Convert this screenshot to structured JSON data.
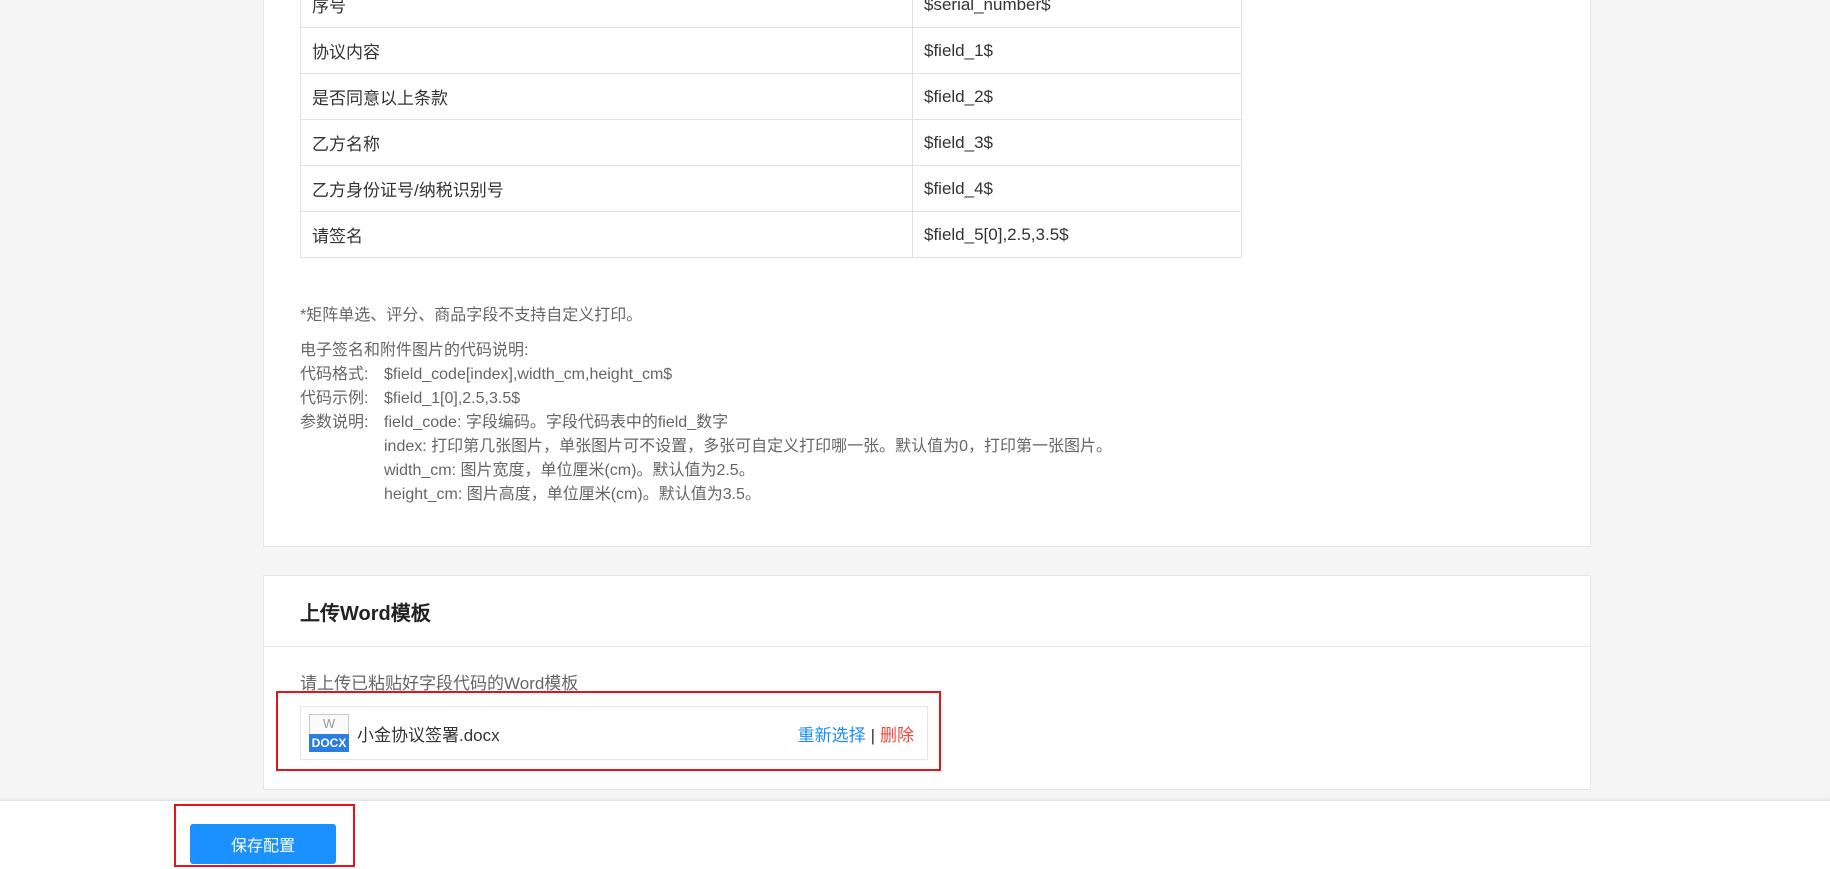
{
  "field_table": {
    "rows": [
      {
        "name": "序号",
        "code": "$serial_number$"
      },
      {
        "name": "协议内容",
        "code": "$field_1$"
      },
      {
        "name": "是否同意以上条款",
        "code": "$field_2$"
      },
      {
        "name": "乙方名称",
        "code": "$field_3$"
      },
      {
        "name": "乙方身份证号/纳税识别号",
        "code": "$field_4$"
      },
      {
        "name": "请签名",
        "code": "$field_5[0],2.5,3.5$"
      }
    ]
  },
  "note": "*矩阵单选、评分、商品字段不支持自定义打印。",
  "help": {
    "title": "电子签名和附件图片的代码说明:",
    "format_label": "代码格式:",
    "format_value": "$field_code[index],width_cm,height_cm$",
    "example_label": "代码示例:",
    "example_value": "$field_1[0],2.5,3.5$",
    "params_label": "参数说明:",
    "param_field_code": "field_code: 字段编码。字段代码表中的field_数字",
    "param_index": "index: 打印第几张图片，单张图片可不设置，多张可自定义打印哪一张。默认值为0，打印第一张图片。",
    "param_width": "width_cm: 图片宽度，单位厘米(cm)。默认值为2.5。",
    "param_height": "height_cm: 图片高度，单位厘米(cm)。默认值为3.5。"
  },
  "upload": {
    "title": "上传Word模板",
    "hint": "请上传已粘贴好字段代码的Word模板",
    "file": {
      "icon_top": "W",
      "icon_tag": "DOCX",
      "name": "小金协议签署.docx",
      "reselect": "重新选择",
      "separator": "|",
      "delete": "删除"
    }
  },
  "footer": {
    "save_label": "保存配置"
  },
  "colors": {
    "primary": "#1b90ff",
    "danger": "#f5483b",
    "highlight": "#e3151c"
  }
}
